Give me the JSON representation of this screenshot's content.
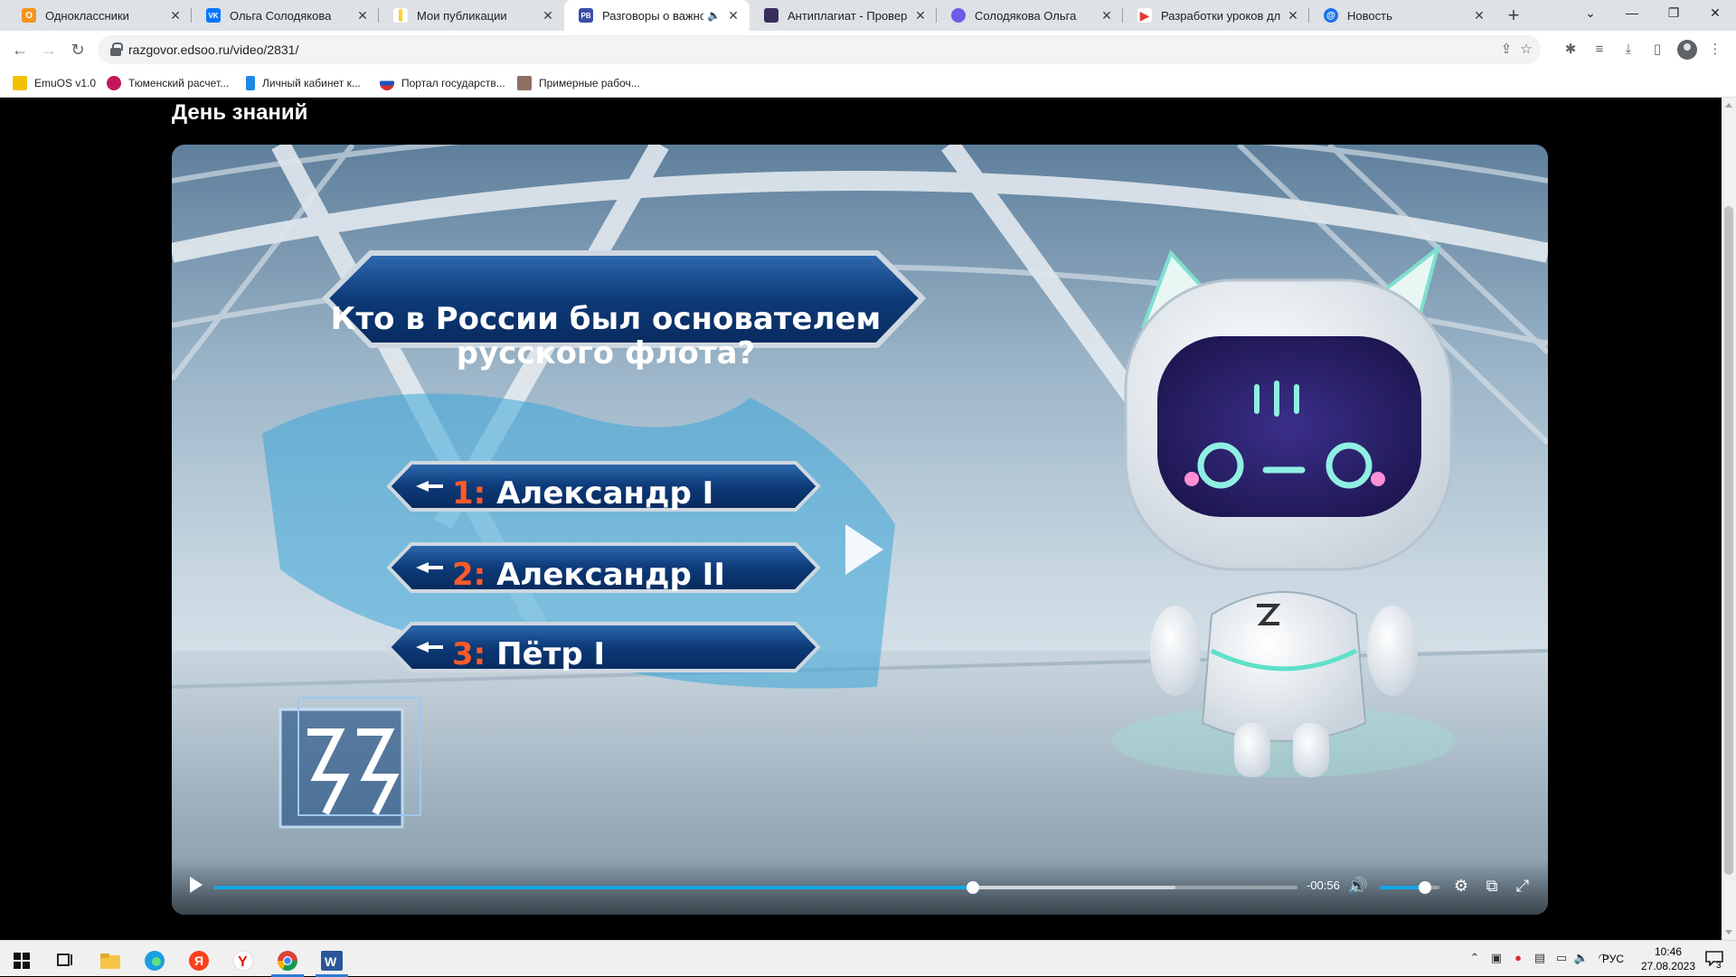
{
  "tabs": [
    {
      "title": "Одноклассники",
      "favicon_color": "#f7931e",
      "favicon_letter": "О",
      "active": false
    },
    {
      "title": "Ольга Солодякова",
      "favicon_color": "#0077ff",
      "favicon_letter": "VK",
      "active": false
    },
    {
      "title": "Мои публикации",
      "favicon_color": "#ffd21f",
      "favicon_letter": "",
      "active": false
    },
    {
      "title": "Разговоры о важном",
      "favicon_color": "#3b4ea8",
      "favicon_letter": "РВ",
      "active": true,
      "audio": true
    },
    {
      "title": "Антиплагиат - Проверить",
      "favicon_color": "#3a2f5c",
      "favicon_letter": "",
      "active": false
    },
    {
      "title": "Солодякова Ольга",
      "favicon_color": "#6c5ce7",
      "favicon_letter": "",
      "active": false
    },
    {
      "title": "Разработки уроков для у",
      "favicon_color": "#e53935",
      "favicon_letter": "",
      "active": false
    },
    {
      "title": "Новость",
      "favicon_color": "#1a73e8",
      "favicon_letter": "@",
      "active": false
    }
  ],
  "toolbar": {
    "url": "razgovor.edsoo.ru/video/2831/",
    "back_icon": "back-arrow-icon",
    "forward_icon": "forward-arrow-icon",
    "reload_icon": "reload-icon"
  },
  "bookmarks": [
    {
      "label": "EmuOS v1.0",
      "color": "#f2c200"
    },
    {
      "label": "Тюменский расчет...",
      "color": "#c2185b"
    },
    {
      "label": "Личный кабинет к...",
      "color": "#1e88e5"
    },
    {
      "label": "Портал государств...",
      "color": "#d32f2f"
    },
    {
      "label": "Примерные рабоч...",
      "color": "#8d6e63"
    }
  ],
  "page": {
    "title": "День знаний"
  },
  "video": {
    "question": "Кто в России был основателем русского флота?",
    "answers": [
      {
        "num": "1:",
        "text": "Александр I"
      },
      {
        "num": "2:",
        "text": "Александр II"
      },
      {
        "num": "3:",
        "text": "Пётр I"
      }
    ],
    "time_remaining": "-00:56",
    "progress_fraction": 0.7,
    "buffered_fraction": 0.887,
    "volume_fraction": 0.75,
    "accent_color": "#12a6e6"
  },
  "taskbar": {
    "language": "РУС",
    "time": "10:46",
    "date": "27.08.2023",
    "notification_count": "3"
  }
}
